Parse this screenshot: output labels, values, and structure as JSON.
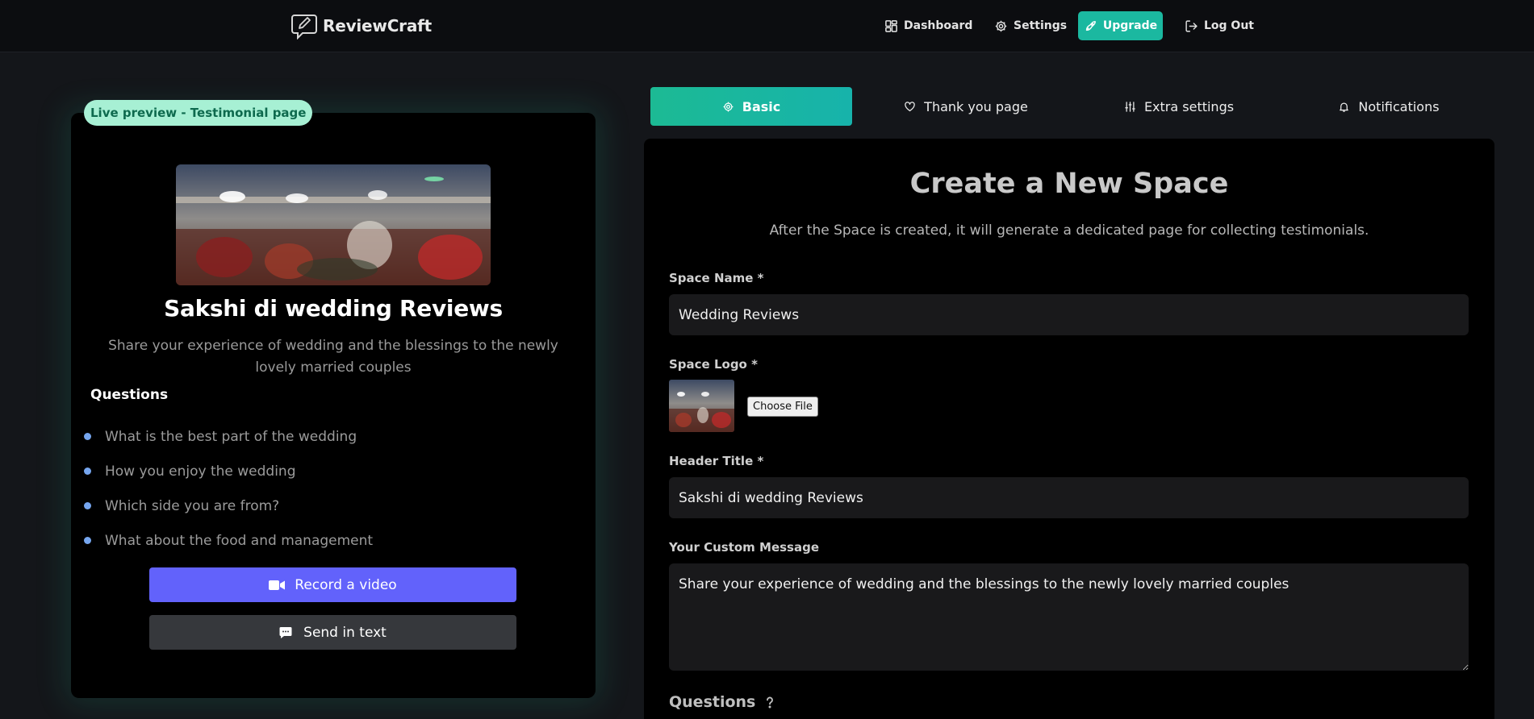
{
  "nav": {
    "brand": "ReviewCraft",
    "items": [
      {
        "label": "Dashboard",
        "icon": "dashboard-icon"
      },
      {
        "label": "Settings",
        "icon": "gear-icon"
      },
      {
        "label": "Upgrade",
        "icon": "rocket-icon"
      },
      {
        "label": "Log Out",
        "icon": "logout-icon"
      }
    ],
    "upgrade_color": "#1bb8a0"
  },
  "preview": {
    "badge": "Live preview - Testimonial page",
    "title": "Sakshi di wedding Reviews",
    "message": "Share your experience of wedding and the blessings to the newly lovely married couples",
    "questions_heading": "Questions",
    "questions": [
      "What is the best part of the wedding",
      "How you enjoy the wedding",
      "Which side you are from?",
      "What about the food and management"
    ],
    "record_video_label": "Record a video",
    "send_text_label": "Send in text",
    "record_color": "#6262fb"
  },
  "tabs": [
    {
      "label": "Basic",
      "icon": "gear-icon",
      "active": true
    },
    {
      "label": "Thank you page",
      "icon": "heart-icon",
      "active": false
    },
    {
      "label": "Extra settings",
      "icon": "sliders-icon",
      "active": false
    },
    {
      "label": "Notifications",
      "icon": "bell-icon",
      "active": false
    }
  ],
  "form": {
    "title": "Create a New Space",
    "subtitle": "After the Space is created, it will generate a dedicated page for collecting testimonials.",
    "space_name_label": "Space Name *",
    "space_name_value": "Wedding Reviews",
    "space_logo_label": "Space Logo *",
    "choose_file_label": "Choose File",
    "header_title_label": "Header Title *",
    "header_title_value": "Sakshi di wedding Reviews",
    "custom_message_label": "Your Custom Message",
    "custom_message_value": "Share your experience of wedding and the blessings to the newly lovely married couples",
    "questions_label": "Questions"
  }
}
